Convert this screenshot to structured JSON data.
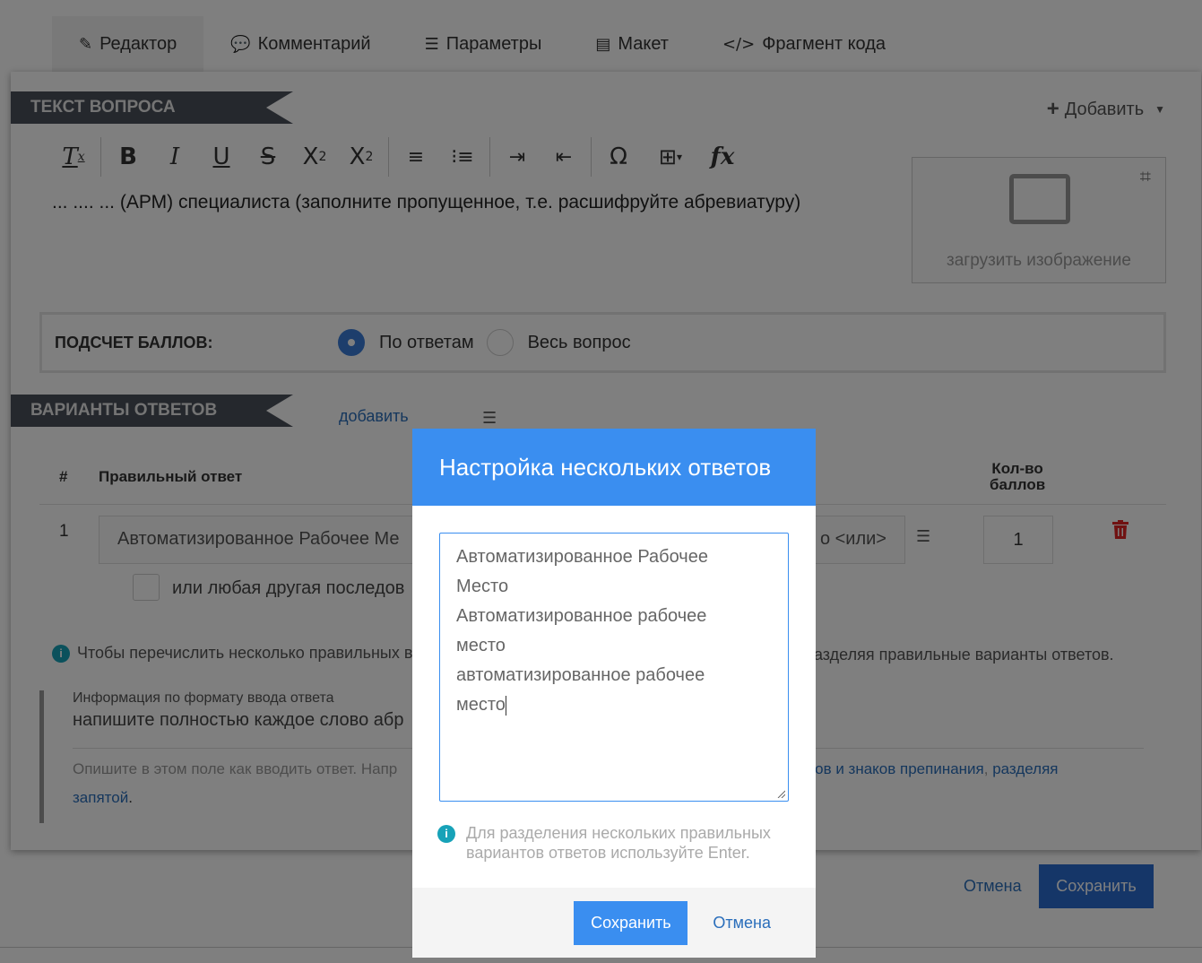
{
  "tabs": [
    {
      "label": "Редактор",
      "icon": "edit-icon",
      "active": true
    },
    {
      "label": "Комментарий",
      "icon": "comment-icon"
    },
    {
      "label": "Параметры",
      "icon": "sliders-icon"
    },
    {
      "label": "Макет",
      "icon": "layout-icon"
    },
    {
      "label": "Фрагмент кода",
      "icon": "code-icon"
    }
  ],
  "question": {
    "section_title": "ТЕКСТ ВОПРОСА",
    "add_label": "Добавить",
    "text": "... .... ... (АРМ) специалиста (заполните пропущенное, т.е. расшифруйте абревиатуру)",
    "upload_label": "загрузить изображение"
  },
  "toolbar": {
    "buttons": [
      "clear-format",
      "bold",
      "italic",
      "underline",
      "strikethrough",
      "subscript",
      "superscript",
      "ordered-list",
      "bullet-list",
      "indent",
      "outdent",
      "special-char",
      "table",
      "formula"
    ]
  },
  "scoring": {
    "label": "ПОДСЧЕТ БАЛЛОВ:",
    "option1": "По ответам",
    "option2": "Весь вопрос",
    "selected": "По ответам"
  },
  "answers": {
    "section_title": "ВАРИАНТЫ ОТВЕТОВ",
    "add_link": "добавить",
    "col_num": "#",
    "col_answer": "Правильный ответ",
    "col_points_1": "Кол-во",
    "col_points_2": "баллов",
    "row_num": "1",
    "row_value": "Автоматизированное Рабочее Ме",
    "row_value_tail": "о <или>",
    "row_points": "1",
    "checkbox_label": "или любая другая последов"
  },
  "info": {
    "hint_left": "Чтобы перечислить несколько правильных в",
    "hint_right": "азделяя правильные варианты ответов.",
    "format_title": "Информация по формату ввода ответа",
    "format_value": "напишите полностью каждое слово абр",
    "desc_left": "Опишите в этом поле как вводить ответ. Напр",
    "desc_right_link": "лов и знаков препинания",
    "desc_right_sep": ", ",
    "desc_right_link2": "разделяя",
    "desc_line2_link": "запятой",
    "desc_line2_tail": "."
  },
  "footer": {
    "cancel": "Отмена",
    "save": "Сохранить"
  },
  "modal": {
    "title": "Настройка нескольких ответов",
    "lines": [
      "Автоматизированное Рабочее",
      "Место",
      "Автоматизированное рабочее",
      "место",
      "автоматизированное рабочее",
      "место"
    ],
    "hint": "Для разделения нескольких правильных вариантов ответов используйте Enter.",
    "save": "Сохранить",
    "cancel": "Отмена"
  },
  "colors": {
    "primary": "#3a8ef0",
    "ribbon": "#4a505a",
    "danger": "#e02424",
    "info": "#17a2b8"
  }
}
